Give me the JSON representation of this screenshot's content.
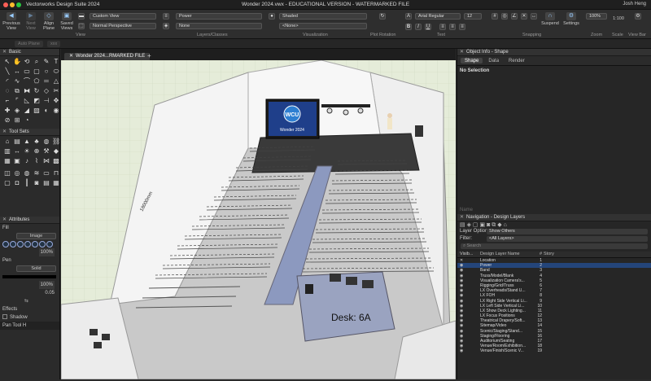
{
  "window": {
    "app_title": "Vectorworks Design Suite 2024",
    "doc_title": "Wonder 2024.vwx - EDUCATIONAL VERSION - WATERMARKED FILE",
    "user": "Josh Heng"
  },
  "toolbar": {
    "previous_view": "Previous View",
    "next_view": "Next View",
    "align_plane": "Align Plane",
    "saved_views": "Saved Views",
    "view_label": "View",
    "custom_view": "Custom View",
    "perspective": "Normal Perspective",
    "layer_value": "Power",
    "class_value": "None",
    "layers_classes_label": "Layers/Classes",
    "render_mode": "Shaded",
    "render_sub": "<None>",
    "visualization_label": "Visualization",
    "plot_rotation_label": "Plot Rotation",
    "font": "Arial Regular",
    "font_size": "12",
    "text_label": "Text",
    "snapping_label": "Snapping",
    "suspend": "Suspend",
    "settings": "Settings",
    "zoom_value": "100%",
    "zoom_label": "Zoom",
    "scale_value": "1:100",
    "scale_label": "Scale",
    "view_bar_label": "View Bar",
    "bold": "B",
    "italic": "I",
    "underline": "U"
  },
  "mode_bar": {
    "tab1": "Auto Plane",
    "tab2": "xxx"
  },
  "left": {
    "basic_title": "Basic",
    "tool_sets_title": "Tool Sets",
    "attributes_title": "Attributes",
    "fill_label": "Fill",
    "fill_value": "Image",
    "pen_label": "Pen",
    "pen_value": "Solid",
    "opacity1": "100%",
    "opacity2": "100%",
    "thickness": "0.05",
    "effects_label": "Effects",
    "shadow_label": "Shadow",
    "tool_status": "Pan Tool  H"
  },
  "canvas": {
    "tab_label": "Wonder 2024...RMARKED FILE",
    "screen_text": "WCU",
    "screen_subtext": "Wonder 2024",
    "desk_label": "Desk: 6A",
    "dimension": "18000mm"
  },
  "object_info": {
    "title": "Object Info - Shape",
    "tabs": [
      "Shape",
      "Data",
      "Render"
    ],
    "no_selection": "No Selection",
    "name_label": "Name"
  },
  "navigation": {
    "title": "Navigation - Design Layers",
    "layer_options_label": "Layer Options:",
    "layer_options_value": "Show Others",
    "filter_label": "Filter:",
    "filter_value": "<All Layers>",
    "search_placeholder": "Search",
    "columns": [
      "Visib...",
      "Design Layer Name",
      "#",
      "Story"
    ],
    "layers": [
      [
        "Location",
        "1"
      ],
      [
        "Power",
        "2"
      ],
      [
        "Band",
        "3"
      ],
      [
        "Truss/Model/Blank",
        "4"
      ],
      [
        "Visualization Camera's...",
        "5"
      ],
      [
        "Rigging/Grid/Truss",
        "6"
      ],
      [
        "LX Overheads/Stand U...",
        "7"
      ],
      [
        "LX FOH",
        "8"
      ],
      [
        "LX Right Side Vertical Li...",
        "9"
      ],
      [
        "LX Left Side Vertical Li...",
        "10"
      ],
      [
        "LX Show Deck Lighting...",
        "11"
      ],
      [
        "LX Focus Positions",
        "12"
      ],
      [
        "Theatrical Drapery/Soft...",
        "13"
      ],
      [
        "Sitemap/Video",
        "14"
      ],
      [
        "Scenic/Staging/Stand...",
        "15"
      ],
      [
        "Staging/Flooring",
        "16"
      ],
      [
        "Auditorium/Seating",
        "17"
      ],
      [
        "Venue/Room/Exhibition...",
        "18"
      ],
      [
        "Venue/Finish/Scenic V...",
        "19"
      ]
    ]
  }
}
